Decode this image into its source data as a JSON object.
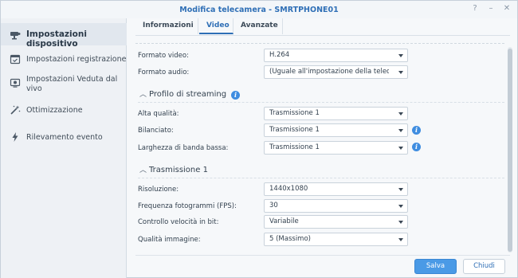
{
  "window": {
    "title": "Modifica telecamera - SMRTPHONE01",
    "controls": [
      "?",
      "–",
      "✕"
    ]
  },
  "sidebar": {
    "items": [
      {
        "label": "Impostazioni dispositivo",
        "icon": "camera-icon",
        "active": true
      },
      {
        "label": "Impostazioni registrazione",
        "icon": "calendar-icon",
        "active": false
      },
      {
        "label": "Impostazioni Veduta dal vivo",
        "icon": "live-view-icon",
        "active": false
      },
      {
        "label": "Ottimizzazione",
        "icon": "magic-wand-icon",
        "active": false
      },
      {
        "label": "Rilevamento evento",
        "icon": "lightning-icon",
        "active": false
      }
    ]
  },
  "tabs": [
    {
      "label": "Informazioni",
      "active": false
    },
    {
      "label": "Video",
      "active": true
    },
    {
      "label": "Avanzate",
      "active": false
    }
  ],
  "format": {
    "video_label": "Formato video:",
    "video_value": "H.264",
    "audio_label": "Formato audio:",
    "audio_value": "(Uguale all'impostazione della telecamera)"
  },
  "streaming": {
    "title": "Profilo di streaming",
    "rows": [
      {
        "label": "Alta qualità:",
        "value": "Trasmissione 1",
        "info": false
      },
      {
        "label": "Bilanciato:",
        "value": "Trasmissione 1",
        "info": true
      },
      {
        "label": "Larghezza di banda bassa:",
        "value": "Trasmissione 1",
        "info": true
      }
    ]
  },
  "stream1": {
    "title": "Trasmissione 1",
    "rows": [
      {
        "label": "Risoluzione:",
        "value": "1440x1080"
      },
      {
        "label": "Frequenza fotogrammi (FPS):",
        "value": "30"
      },
      {
        "label": "Controllo velocità in bit:",
        "value": "Variabile"
      },
      {
        "label": "Qualità immagine:",
        "value": "5 (Massimo)"
      }
    ]
  },
  "footer": {
    "save_label": "Salva",
    "close_label": "Chiudi"
  },
  "colors": {
    "accent": "#2f6fb6",
    "primary_button": "#4a9ae6",
    "info": "#3f8de0"
  }
}
